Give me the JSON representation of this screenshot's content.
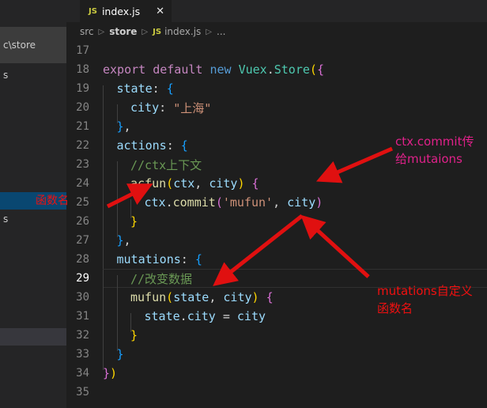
{
  "window": {
    "theme": "vscode-dark",
    "bg": "#1e1e1e",
    "sidebar_bg": "#252526",
    "accent_selected": "#094771"
  },
  "sidebar": {
    "tooltip": "c\\store",
    "rows": [
      {
        "label": "s",
        "state": "normal"
      },
      {
        "label": "",
        "state": "selected"
      },
      {
        "label": "s",
        "state": "normal"
      },
      {
        "label": "",
        "state": "hover"
      }
    ]
  },
  "tab": {
    "icon": "js-file-icon",
    "badge": "JS",
    "label": "index.js",
    "close": "✕",
    "active": true
  },
  "breadcrumb": {
    "separator": "▷",
    "js_badge": "JS",
    "items": [
      "src",
      "store",
      "index.js",
      "..."
    ]
  },
  "editor": {
    "first_line_number": 17,
    "active_line": 29,
    "lines": [
      {
        "n": 17,
        "segments": []
      },
      {
        "n": 18,
        "segments": [
          {
            "t": "export",
            "c": "t-kw"
          },
          {
            "t": " ",
            "c": "t-pl"
          },
          {
            "t": "default",
            "c": "t-kw"
          },
          {
            "t": " ",
            "c": "t-pl"
          },
          {
            "t": "new",
            "c": "t-blue"
          },
          {
            "t": " ",
            "c": "t-pl"
          },
          {
            "t": "Vuex",
            "c": "t-type"
          },
          {
            "t": ".",
            "c": "t-pl"
          },
          {
            "t": "Store",
            "c": "t-type"
          },
          {
            "t": "(",
            "c": "t-py"
          },
          {
            "t": "{",
            "c": "t-pp"
          }
        ]
      },
      {
        "n": 19,
        "indent": 1,
        "segments": [
          {
            "t": "state",
            "c": "t-var"
          },
          {
            "t": ": ",
            "c": "t-pl"
          },
          {
            "t": "{",
            "c": "t-pb"
          }
        ]
      },
      {
        "n": 20,
        "indent": 2,
        "segments": [
          {
            "t": "city",
            "c": "t-var"
          },
          {
            "t": ": ",
            "c": "t-pl"
          },
          {
            "t": "\"上海\"",
            "c": "t-str"
          }
        ]
      },
      {
        "n": 21,
        "indent": 1,
        "segments": [
          {
            "t": "}",
            "c": "t-pb"
          },
          {
            "t": ",",
            "c": "t-pl"
          }
        ]
      },
      {
        "n": 22,
        "indent": 1,
        "segments": [
          {
            "t": "actions",
            "c": "t-var"
          },
          {
            "t": ": ",
            "c": "t-pl"
          },
          {
            "t": "{",
            "c": "t-pb"
          }
        ]
      },
      {
        "n": 23,
        "indent": 2,
        "segments": [
          {
            "t": "//ctx上下文",
            "c": "t-cmt"
          }
        ]
      },
      {
        "n": 24,
        "indent": 2,
        "segments": [
          {
            "t": "acfun",
            "c": "t-fn"
          },
          {
            "t": "(",
            "c": "t-py"
          },
          {
            "t": "ctx",
            "c": "t-var"
          },
          {
            "t": ", ",
            "c": "t-pl"
          },
          {
            "t": "city",
            "c": "t-var"
          },
          {
            "t": ")",
            "c": "t-py"
          },
          {
            "t": " ",
            "c": "t-pl"
          },
          {
            "t": "{",
            "c": "t-pp"
          }
        ]
      },
      {
        "n": 25,
        "indent": 3,
        "segments": [
          {
            "t": "ctx",
            "c": "t-var"
          },
          {
            "t": ".",
            "c": "t-pl"
          },
          {
            "t": "commit",
            "c": "t-fn"
          },
          {
            "t": "(",
            "c": "t-pp"
          },
          {
            "t": "'mufun'",
            "c": "t-str"
          },
          {
            "t": ", ",
            "c": "t-pl"
          },
          {
            "t": "city",
            "c": "t-var"
          },
          {
            "t": ")",
            "c": "t-pp"
          }
        ]
      },
      {
        "n": 26,
        "indent": 2,
        "segments": [
          {
            "t": "}",
            "c": "t-py"
          }
        ]
      },
      {
        "n": 27,
        "indent": 1,
        "segments": [
          {
            "t": "}",
            "c": "t-pb"
          },
          {
            "t": ",",
            "c": "t-pl"
          }
        ]
      },
      {
        "n": 28,
        "indent": 1,
        "segments": [
          {
            "t": "mutations",
            "c": "t-var"
          },
          {
            "t": ": ",
            "c": "t-pl"
          },
          {
            "t": "{",
            "c": "t-pb"
          }
        ]
      },
      {
        "n": 29,
        "indent": 2,
        "active": true,
        "segments": [
          {
            "t": "//改变数据",
            "c": "t-cmt"
          }
        ]
      },
      {
        "n": 30,
        "indent": 2,
        "segments": [
          {
            "t": "mufun",
            "c": "t-fn"
          },
          {
            "t": "(",
            "c": "t-py"
          },
          {
            "t": "state",
            "c": "t-var"
          },
          {
            "t": ", ",
            "c": "t-pl"
          },
          {
            "t": "city",
            "c": "t-var"
          },
          {
            "t": ")",
            "c": "t-py"
          },
          {
            "t": " ",
            "c": "t-pl"
          },
          {
            "t": "{",
            "c": "t-pp"
          }
        ]
      },
      {
        "n": 31,
        "indent": 3,
        "segments": [
          {
            "t": "state",
            "c": "t-var"
          },
          {
            "t": ".",
            "c": "t-pl"
          },
          {
            "t": "city",
            "c": "t-var"
          },
          {
            "t": " = ",
            "c": "t-pl"
          },
          {
            "t": "city",
            "c": "t-var"
          }
        ]
      },
      {
        "n": 32,
        "indent": 2,
        "segments": [
          {
            "t": "}",
            "c": "t-py"
          }
        ]
      },
      {
        "n": 33,
        "indent": 1,
        "segments": [
          {
            "t": "}",
            "c": "t-pb"
          }
        ]
      },
      {
        "n": 34,
        "indent": 0,
        "segments": [
          {
            "t": "}",
            "c": "t-pp"
          },
          {
            "t": ")",
            "c": "t-py"
          }
        ]
      },
      {
        "n": 35,
        "segments": []
      }
    ]
  },
  "annotations": [
    {
      "id": "anno-commit",
      "text": "ctx.commit传\n给mutaions",
      "color": "#e0218a"
    },
    {
      "id": "anno-mutations",
      "text": "mutations自定义\n函数名",
      "color": "#f01010"
    },
    {
      "id": "anno-fnname",
      "text": "函数名",
      "color": "#f01010"
    }
  ],
  "arrow_color": "#e01010"
}
